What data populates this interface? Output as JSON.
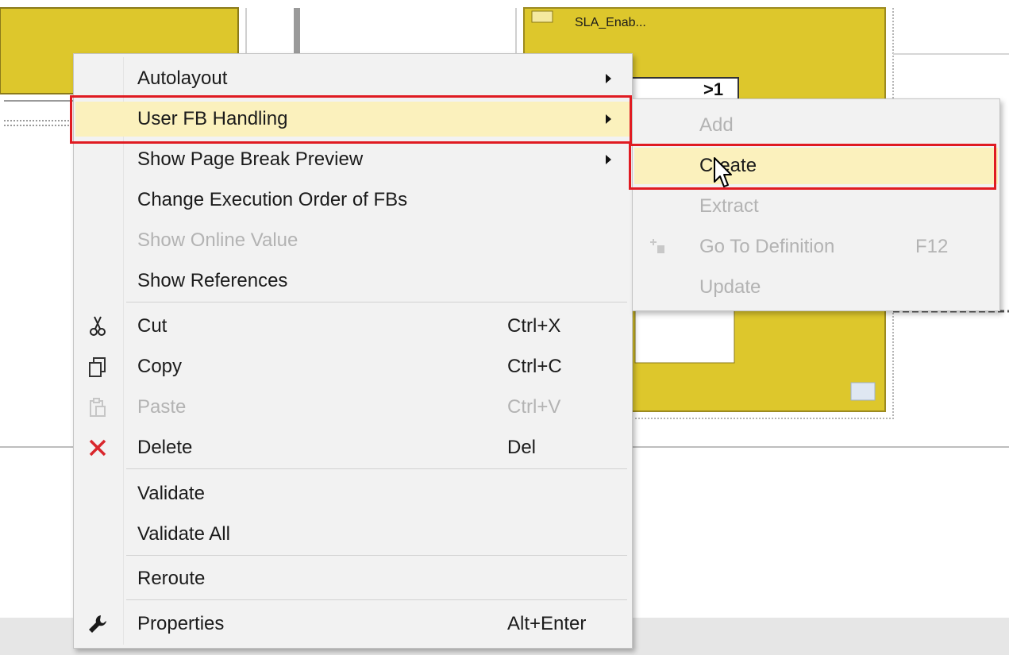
{
  "diagram": {
    "block_label_line2": "SLA_Enab...",
    "gate_symbol": ">1"
  },
  "context_menu": {
    "items": [
      {
        "label": "Autolayout",
        "submenu": true
      },
      {
        "label": "User FB Handling",
        "submenu": true,
        "highlighted": true
      },
      {
        "label": "Show Page Break Preview",
        "submenu": true
      },
      {
        "label": "Change Execution Order of FBs"
      },
      {
        "label": "Show Online Value",
        "disabled": true
      },
      {
        "label": "Show References"
      },
      {
        "label": "Cut",
        "shortcut": "Ctrl+X",
        "icon": "scissors-icon"
      },
      {
        "label": "Copy",
        "shortcut": "Ctrl+C",
        "icon": "copy-icon"
      },
      {
        "label": "Paste",
        "shortcut": "Ctrl+V",
        "icon": "paste-icon",
        "disabled": true
      },
      {
        "label": "Delete",
        "shortcut": "Del",
        "icon": "delete-x-icon"
      },
      {
        "label": "Validate"
      },
      {
        "label": "Validate All"
      },
      {
        "label": "Reroute"
      },
      {
        "label": "Properties",
        "shortcut": "Alt+Enter",
        "icon": "wrench-icon"
      }
    ]
  },
  "submenu": {
    "items": [
      {
        "label": "Add",
        "disabled": true
      },
      {
        "label": "Create",
        "highlighted": true
      },
      {
        "label": "Extract",
        "disabled": true
      },
      {
        "label": "Go To Definition",
        "shortcut": "F12",
        "disabled": true,
        "icon": "go-to-definition-icon"
      },
      {
        "label": "Update",
        "disabled": true
      }
    ]
  },
  "colors": {
    "block_yellow": "#ddc72c",
    "highlight": "#fbf1bd",
    "annotation_red": "#e01b22",
    "delete_red": "#d9262c"
  }
}
